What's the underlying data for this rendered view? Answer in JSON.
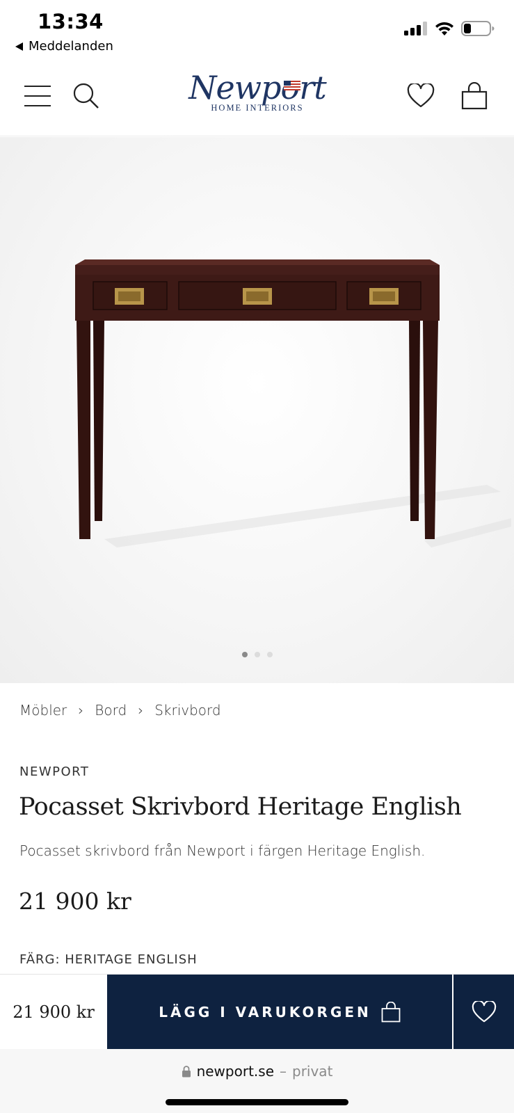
{
  "status_bar": {
    "time": "13:34",
    "back_label": "Meddelanden",
    "icons": [
      "cellular-signal-icon",
      "wifi-icon",
      "battery-icon"
    ]
  },
  "header": {
    "logo_wordmark": "Newport",
    "logo_subtitle": "HOME INTERIORS",
    "icons": [
      "menu-icon",
      "search-icon",
      "heart-icon",
      "shopping-bag-icon"
    ]
  },
  "gallery": {
    "image_subject": "dark wood writing desk with three brass-handled drawers",
    "slide_count": 3,
    "active_slide": 1
  },
  "breadcrumb": {
    "items": [
      "Möbler",
      "Bord",
      "Skrivbord"
    ],
    "separator": "›"
  },
  "product": {
    "brand": "NEWPORT",
    "title": "Pocasset Skrivbord Heritage English",
    "description": "Pocasset skrivbord från Newport i färgen Heritage English.",
    "price": "21 900 kr",
    "color_label": "FÄRG: HERITAGE ENGLISH"
  },
  "buy_bar": {
    "price": "21 900 kr",
    "add_to_cart_label": "LÄGG I VARUKORGEN"
  },
  "browser": {
    "domain": "newport.se",
    "mode_separator": "–",
    "mode": "privat"
  },
  "colors": {
    "brand_navy": "#0e2240",
    "logo_blue": "#1f3563",
    "wood": "#3e1a16",
    "brass": "#b8954a"
  }
}
